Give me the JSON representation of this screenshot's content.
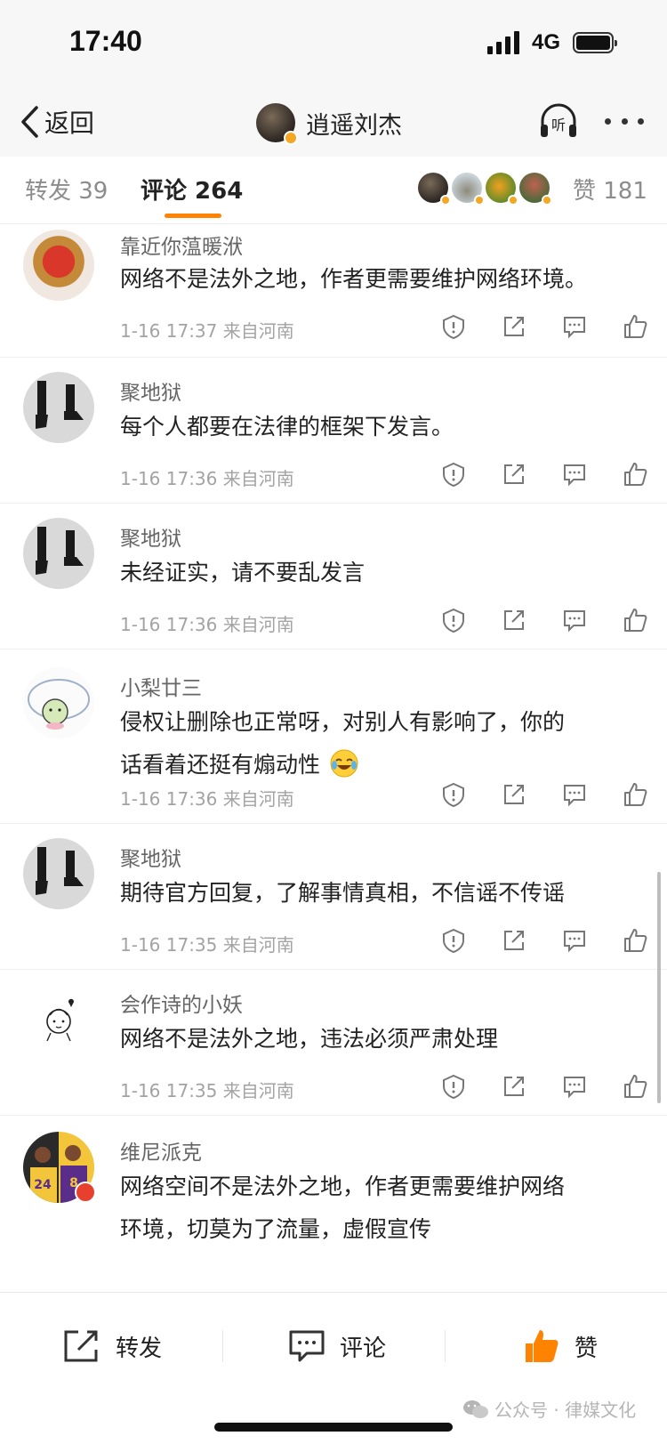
{
  "status_bar": {
    "time": "17:40",
    "network": "4G"
  },
  "nav": {
    "back_label": "返回",
    "title": "逍遥刘杰",
    "listen_label": "听"
  },
  "tabs": {
    "repost": "转发 39",
    "comment": "评论 264",
    "likes": "赞 181"
  },
  "comments": [
    {
      "name": "靠近你蕰暖洑",
      "text": "网络不是法外之地，作者更需要维护网络环境。",
      "meta": "1-16 17:37 来自河南"
    },
    {
      "name": "聚地狱",
      "text": "每个人都要在法律的框架下发言。",
      "meta": "1-16 17:36 来自河南"
    },
    {
      "name": "聚地狱",
      "text": "未经证实，请不要乱发言",
      "meta": "1-16 17:36 来自河南"
    },
    {
      "name": "小梨廿三",
      "text_line1": "侵权让删除也正常呀，对别人有影响了，你的",
      "text_line2": "话看着还挺有煽动性",
      "meta": "1-16 17:36 来自河南"
    },
    {
      "name": "聚地狱",
      "text": "期待官方回复，了解事情真相，不信谣不传谣",
      "meta": "1-16 17:35 来自河南"
    },
    {
      "name": "会作诗的小妖",
      "text": "网络不是法外之地，违法必须严肃处理",
      "meta": "1-16 17:35 来自河南"
    },
    {
      "name": "维尼派克",
      "text_line1": "网络空间不是法外之地，作者更需要维护网络",
      "text_line2": "环境，切莫为了流量，虚假宣传"
    }
  ],
  "bottom_bar": {
    "repost_label": "转发",
    "comment_label": "评论",
    "like_label": "赞",
    "like_color": "#ff8200"
  },
  "watermark": "公众号 · 律媒文化",
  "colors": {
    "accent": "#ff8200",
    "badge": "#f5a623"
  }
}
